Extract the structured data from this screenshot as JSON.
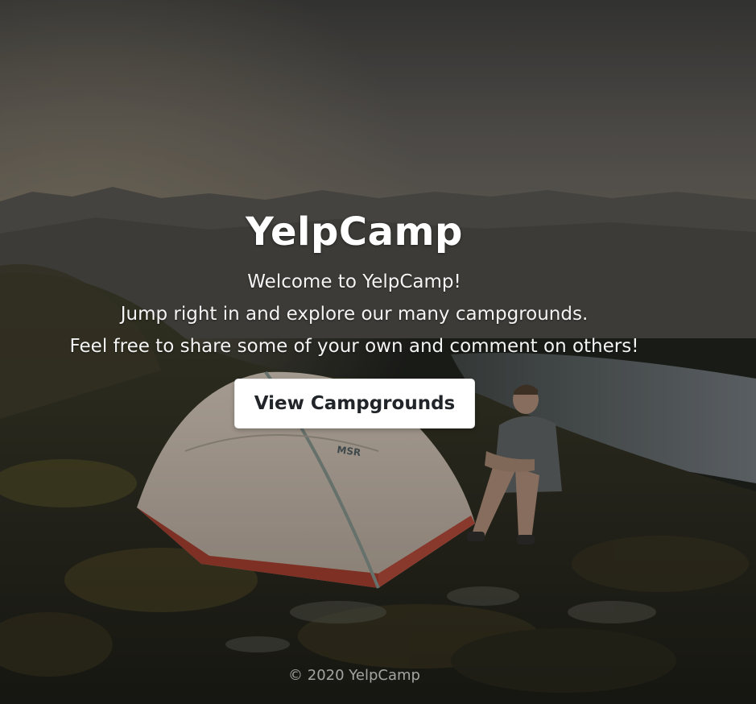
{
  "hero": {
    "title": "YelpCamp",
    "lines": [
      "Welcome to YelpCamp!",
      "Jump right in and explore our many campgrounds.",
      "Feel free to share some of your own and comment on others!"
    ],
    "cta_label": "View Campgrounds"
  },
  "footer": {
    "copyright": "© 2020 YelpCamp"
  },
  "background": {
    "description_icon": "campsite-photo",
    "overlay_color": "#000000"
  },
  "colors": {
    "text": "#ffffff",
    "button_bg": "#ffffff",
    "button_text": "#212529"
  }
}
